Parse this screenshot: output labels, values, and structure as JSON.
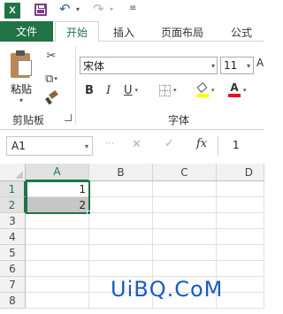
{
  "qat": {
    "app_icon": "excel-icon",
    "app_letter": "X",
    "save_icon": "save-icon",
    "undo_icon": "undo-icon",
    "redo_icon": "redo-icon",
    "customize_icon": "customize-qat-icon"
  },
  "tabs": {
    "file": "文件",
    "items": [
      "开始",
      "插入",
      "页面布局",
      "公式"
    ],
    "active": "开始"
  },
  "clipboard": {
    "paste_label": "粘贴",
    "group_label": "剪贴板",
    "cut_icon": "scissors-icon",
    "copy_icon": "copy-icon",
    "format_painter_icon": "format-painter-icon"
  },
  "font": {
    "group_label": "字体",
    "name": "宋体",
    "size": "11",
    "bold": "B",
    "italic": "I",
    "underline": "U",
    "fill_color": "#ffff00",
    "font_color": "#e81123",
    "font_color_letter": "A"
  },
  "formula_bar": {
    "name_box": "A1",
    "cancel": "✕",
    "enter": "✓",
    "fx": "fx",
    "value": "1"
  },
  "grid": {
    "columns": [
      "A",
      "B",
      "C",
      "D"
    ],
    "rows": [
      "1",
      "2",
      "3",
      "4",
      "5",
      "6",
      "7",
      "8"
    ],
    "cells": {
      "A1": "1",
      "A2": "2"
    },
    "selection": "A1:A2"
  },
  "watermark": "UiBQ.CoM",
  "colors": {
    "accent": "#217346",
    "selection_fill": "#c6c6c6"
  }
}
